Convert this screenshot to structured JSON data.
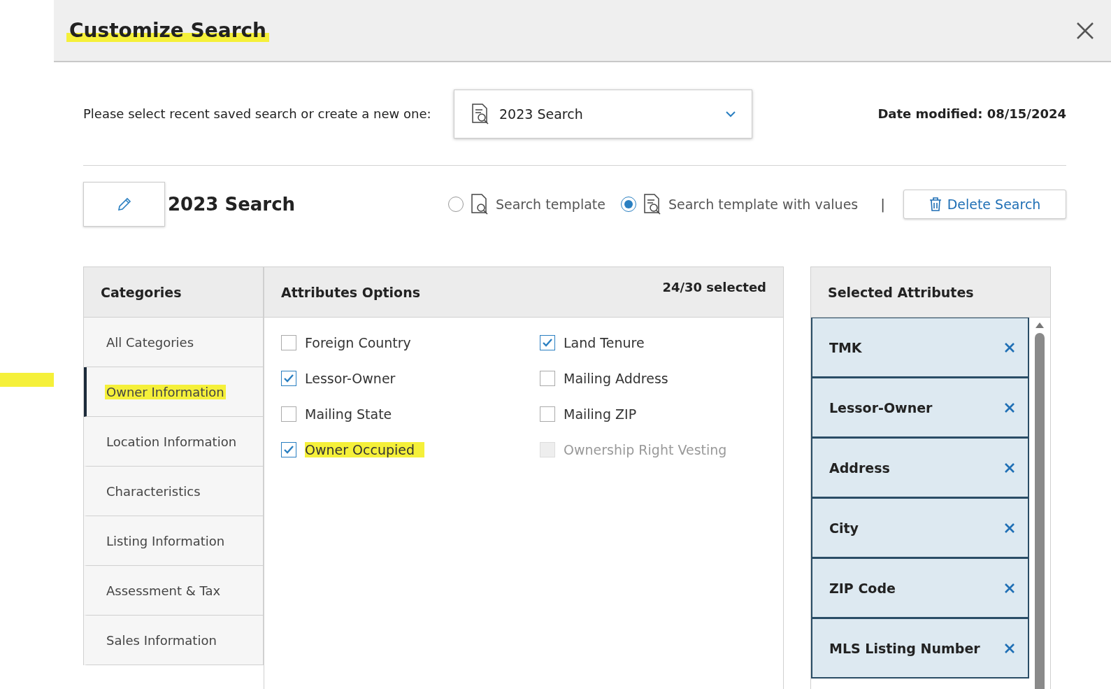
{
  "dialog": {
    "title": "Customize Search",
    "title_highlighted": true
  },
  "saved_search": {
    "label": "Please select recent saved search or create a new one:",
    "value": "2023 Search",
    "date_modified": "Date modified: 08/15/2024"
  },
  "search_name": "2023 Search",
  "template_options": [
    {
      "label": "Search template",
      "selected": false
    },
    {
      "label": "Search template with values",
      "selected": true
    }
  ],
  "separator": "|",
  "delete_button": "Delete Search",
  "categories": {
    "heading": "Categories",
    "items": [
      {
        "label": "All Categories",
        "selected": false,
        "highlighted": false
      },
      {
        "label": "Owner Information",
        "selected": true,
        "highlighted": true
      },
      {
        "label": "Location Information",
        "selected": false,
        "highlighted": false
      },
      {
        "label": "Characteristics",
        "selected": false,
        "highlighted": false
      },
      {
        "label": "Listing Information",
        "selected": false,
        "highlighted": false
      },
      {
        "label": "Assessment & Tax",
        "selected": false,
        "highlighted": false
      },
      {
        "label": "Sales Information",
        "selected": false,
        "highlighted": false
      }
    ]
  },
  "attributes": {
    "heading": "Attributes Options",
    "count": "24/30 selected",
    "items": [
      {
        "label": "Foreign Country",
        "checked": false,
        "disabled": false,
        "highlighted": false
      },
      {
        "label": "Land Tenure",
        "checked": true,
        "disabled": false,
        "highlighted": false
      },
      {
        "label": "Lessor-Owner",
        "checked": true,
        "disabled": false,
        "highlighted": false
      },
      {
        "label": "Mailing Address",
        "checked": false,
        "disabled": false,
        "highlighted": false
      },
      {
        "label": "Mailing State",
        "checked": false,
        "disabled": false,
        "highlighted": false
      },
      {
        "label": "Mailing ZIP",
        "checked": false,
        "disabled": false,
        "highlighted": false
      },
      {
        "label": "Owner Occupied",
        "checked": true,
        "disabled": false,
        "highlighted": true
      },
      {
        "label": "Ownership Right Vesting",
        "checked": false,
        "disabled": true,
        "highlighted": false
      }
    ]
  },
  "selected_attributes": {
    "heading": "Selected Attributes",
    "items": [
      "TMK",
      "Lessor-Owner",
      "Address",
      "City",
      "ZIP Code",
      "MLS Listing Number"
    ]
  }
}
